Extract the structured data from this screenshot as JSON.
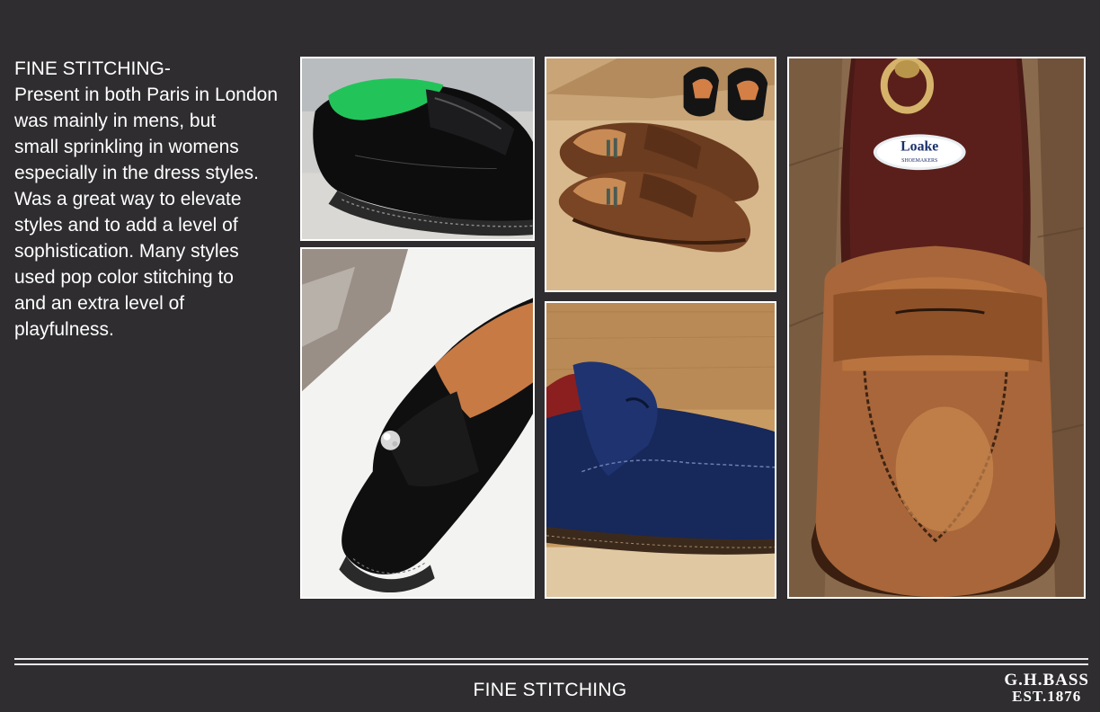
{
  "body_text": {
    "heading": "FINE STITCHING-",
    "lines": [
      "Present in both Paris in London",
      "was mainly in mens, but",
      "small sprinkling in womens",
      "especially in the dress styles.",
      "Was a great way to elevate",
      "styles and to add a level of",
      "sophistication. Many styles",
      "used pop color stitching to",
      "and an extra level of",
      "playfulness."
    ]
  },
  "photos": {
    "loake_tree_text": "Loake",
    "loake_tree_subtext": "SHOEMAKERS"
  },
  "footer": {
    "title": "FINE STITCHING",
    "brand_line1": "G.H.BASS",
    "brand_line2": "EST.1876"
  },
  "colors": {
    "background": "#2f2d30",
    "text": "#ffffff",
    "rule": "#e9e9e9"
  }
}
